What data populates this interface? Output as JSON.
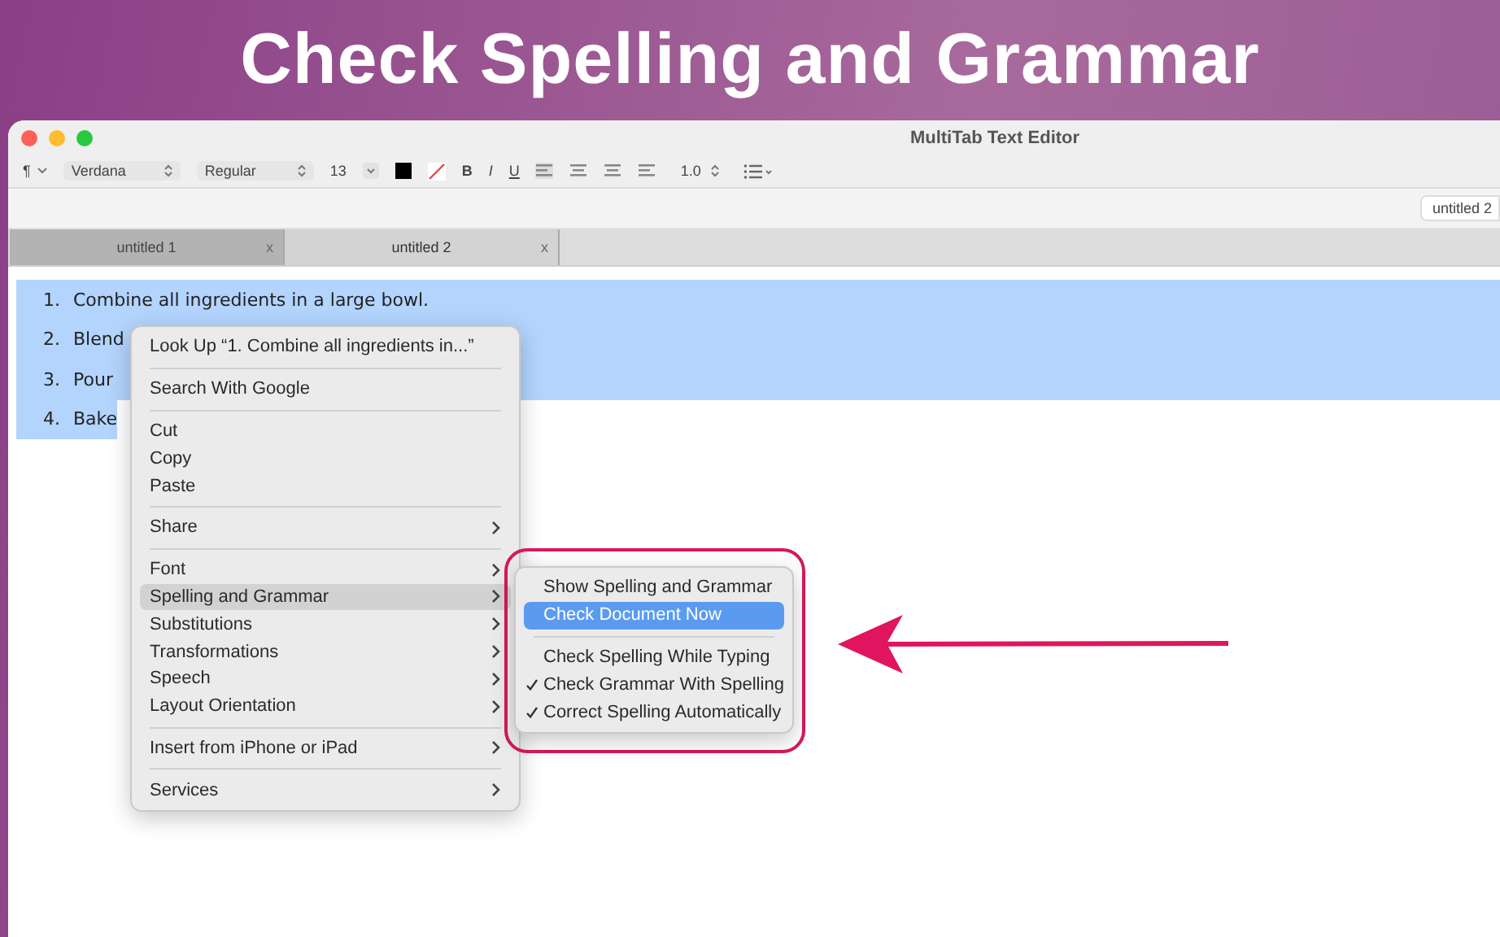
{
  "banner": {
    "title": "Check Spelling and Grammar"
  },
  "window": {
    "title": "MultiTab Text Editor"
  },
  "toolbar": {
    "paragraph": "¶",
    "font": "Verdana",
    "style": "Regular",
    "size": "13",
    "bold": "B",
    "italic": "I",
    "underline": "U",
    "line_spacing": "1.0"
  },
  "open_document_pill": "untitled 2",
  "tabs": [
    {
      "label": "untitled 1",
      "close": "x",
      "selected": false
    },
    {
      "label": "untitled 2",
      "close": "x",
      "selected": true
    }
  ],
  "document": {
    "items": [
      {
        "number": "1.",
        "text": "Combine all ingredients in a large bowl.",
        "selected": true
      },
      {
        "number": "2.",
        "text": "Blend",
        "selected": true
      },
      {
        "number": "3.",
        "text": "Pour",
        "selected": true
      },
      {
        "number": "4.",
        "text": "Bake",
        "selected": true
      }
    ]
  },
  "context_menu": {
    "items": [
      {
        "kind": "item",
        "label": "Look Up “1.    Combine all ingredients in...”",
        "submenu": false,
        "selected": false
      },
      {
        "kind": "separator"
      },
      {
        "kind": "item",
        "label": "Search With Google",
        "submenu": false,
        "selected": false
      },
      {
        "kind": "separator"
      },
      {
        "kind": "item",
        "label": "Cut",
        "submenu": false,
        "selected": false
      },
      {
        "kind": "item",
        "label": "Copy",
        "submenu": false,
        "selected": false
      },
      {
        "kind": "item",
        "label": "Paste",
        "submenu": false,
        "selected": false
      },
      {
        "kind": "separator"
      },
      {
        "kind": "item",
        "label": "Share",
        "submenu": true,
        "selected": false
      },
      {
        "kind": "separator"
      },
      {
        "kind": "item",
        "label": "Font",
        "submenu": true,
        "selected": false
      },
      {
        "kind": "item",
        "label": "Spelling and Grammar",
        "submenu": true,
        "selected": true
      },
      {
        "kind": "item",
        "label": "Substitutions",
        "submenu": true,
        "selected": false
      },
      {
        "kind": "item",
        "label": "Transformations",
        "submenu": true,
        "selected": false
      },
      {
        "kind": "item",
        "label": "Speech",
        "submenu": true,
        "selected": false
      },
      {
        "kind": "item",
        "label": "Layout Orientation",
        "submenu": true,
        "selected": false
      },
      {
        "kind": "separator"
      },
      {
        "kind": "item",
        "label": "Insert from iPhone or iPad",
        "submenu": true,
        "selected": false
      },
      {
        "kind": "separator"
      },
      {
        "kind": "item",
        "label": "Services",
        "submenu": true,
        "selected": false
      }
    ]
  },
  "spelling_submenu": {
    "items": [
      {
        "kind": "item",
        "label": "Show Spelling and Grammar",
        "checked": false,
        "selected": false
      },
      {
        "kind": "item",
        "label": "Check Document Now",
        "checked": false,
        "selected": true
      },
      {
        "kind": "separator"
      },
      {
        "kind": "item",
        "label": "Check Spelling While Typing",
        "checked": false,
        "selected": false
      },
      {
        "kind": "item",
        "label": "Check Grammar With Spelling",
        "checked": true,
        "selected": false
      },
      {
        "kind": "item",
        "label": "Correct Spelling Automatically",
        "checked": true,
        "selected": false
      }
    ]
  }
}
